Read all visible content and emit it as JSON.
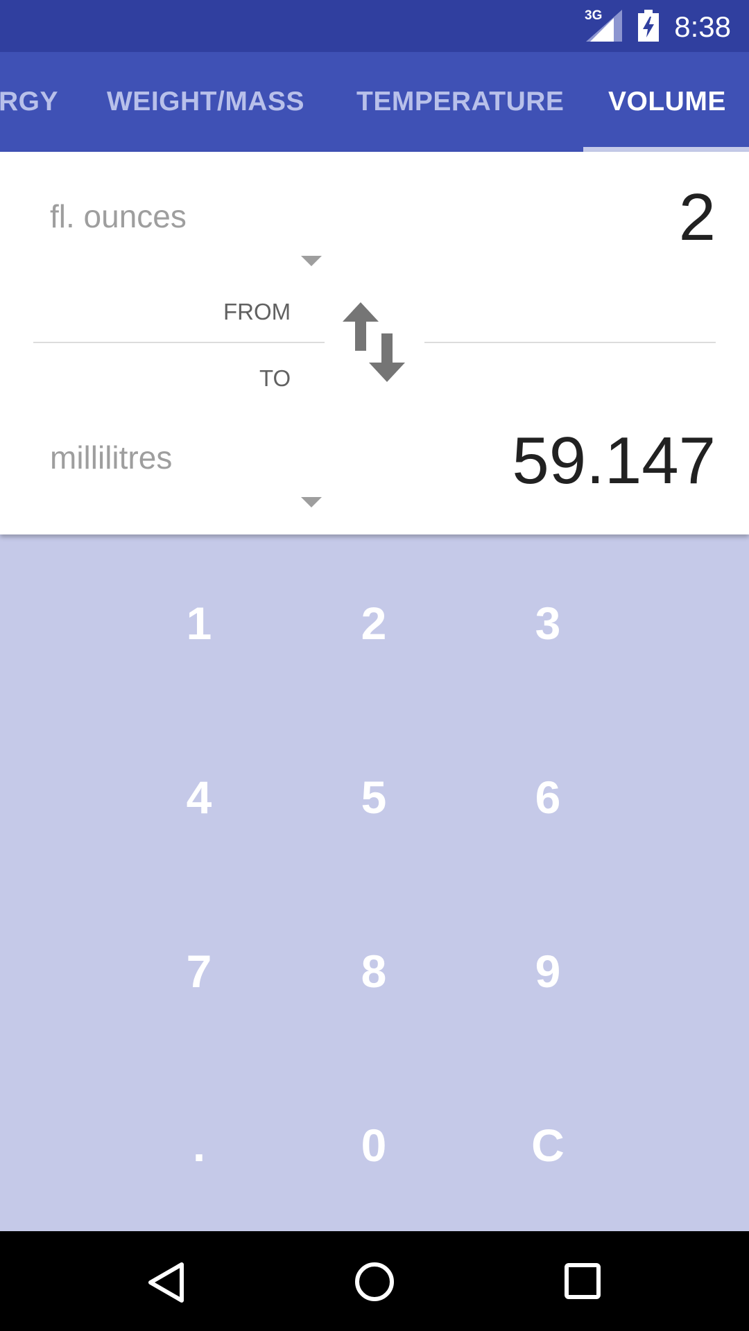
{
  "status_bar": {
    "network": "3G",
    "time": "8:38",
    "icons": [
      "signal-icon",
      "battery-charging-icon"
    ]
  },
  "tabs": [
    {
      "label": "RGY",
      "active": false
    },
    {
      "label": "WEIGHT/MASS",
      "active": false
    },
    {
      "label": "TEMPERATURE",
      "active": false
    },
    {
      "label": "VOLUME",
      "active": true
    }
  ],
  "converter": {
    "from_unit": "fl. ounces",
    "from_value": "2",
    "from_label": "FROM",
    "to_label": "TO",
    "to_unit": "millilitres",
    "to_value": "59.147"
  },
  "keypad": {
    "keys": [
      "1",
      "2",
      "3",
      "4",
      "5",
      "6",
      "7",
      "8",
      "9",
      ".",
      "0",
      "C"
    ]
  },
  "colors": {
    "status_bar": "#303f9f",
    "app_bar": "#3f51b5",
    "keypad_bg": "#c5c9e8",
    "nav_bar": "#000000"
  }
}
